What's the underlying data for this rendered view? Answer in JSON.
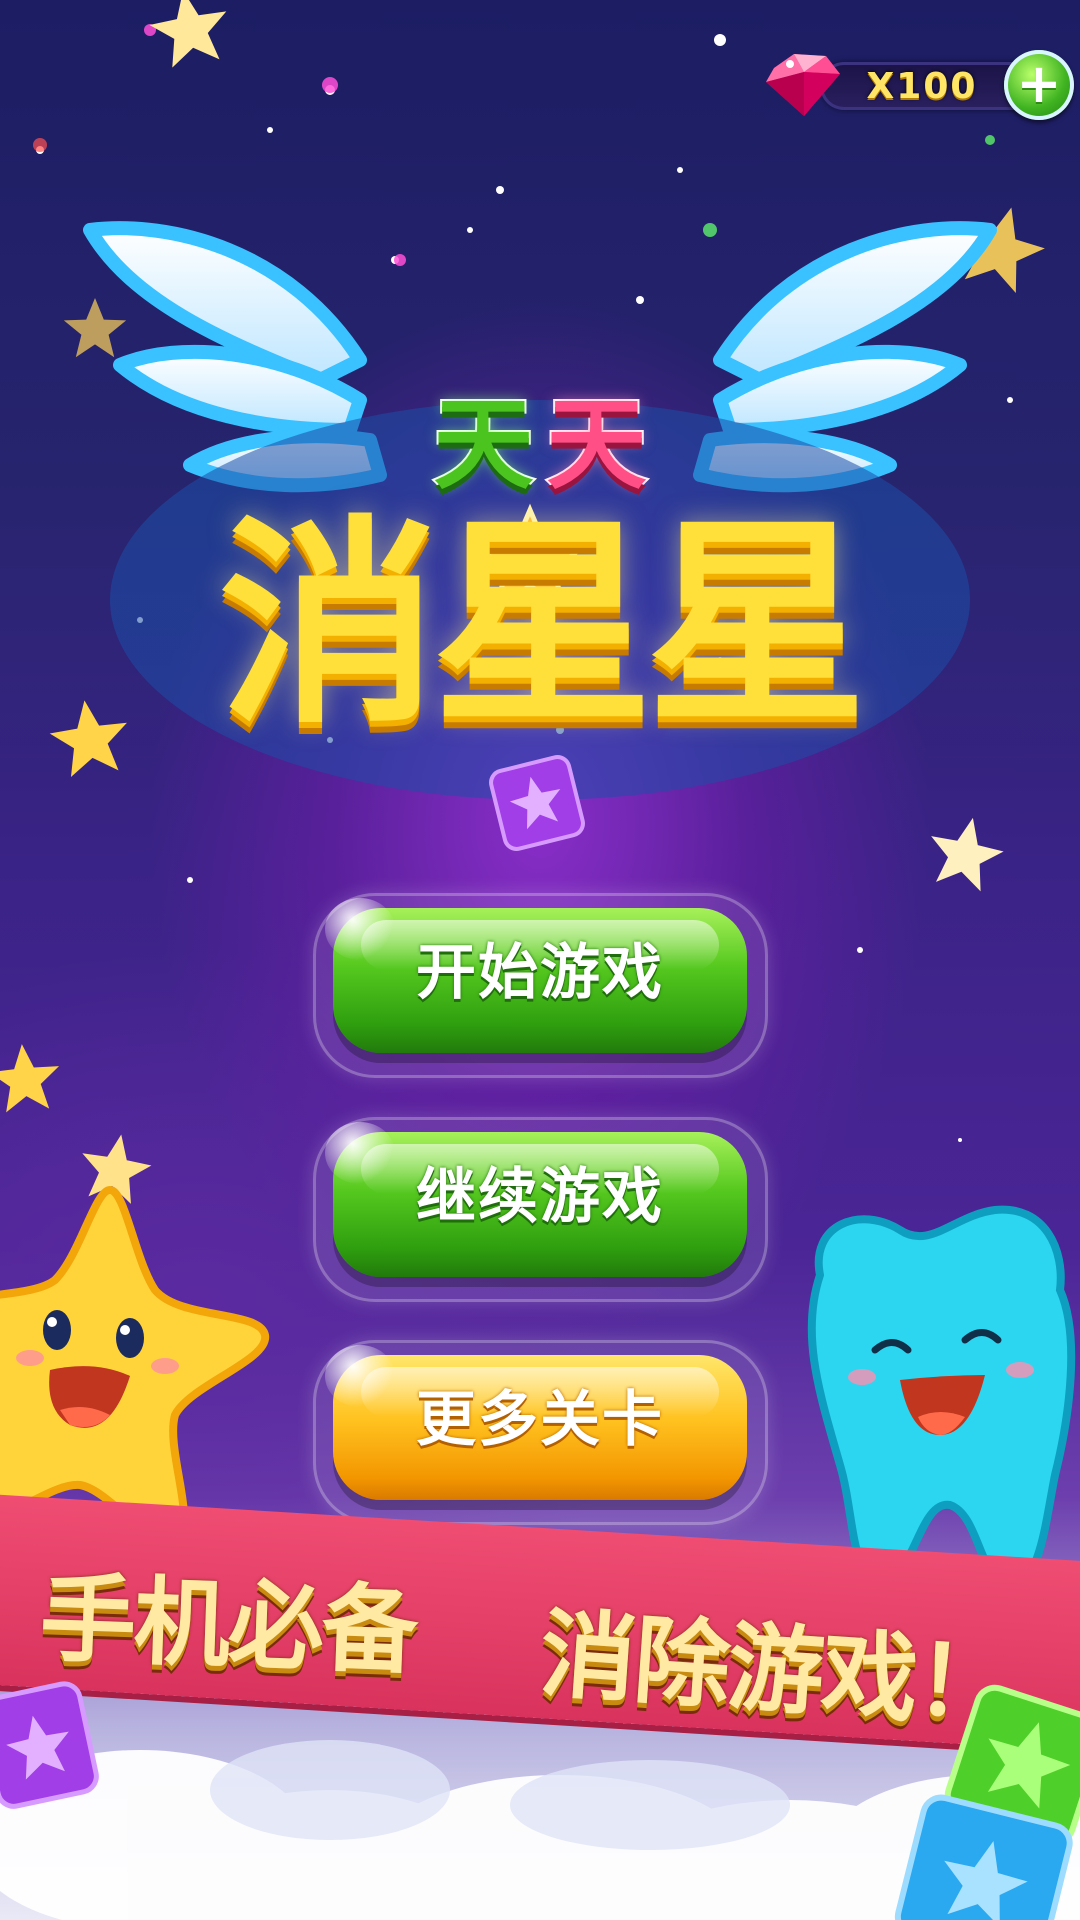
{
  "hud": {
    "gem_count": "X100",
    "add_icon": "plus-icon",
    "gem_icon": "gem-icon"
  },
  "logo": {
    "line1": [
      "天",
      "天"
    ],
    "line2": "消星星"
  },
  "menu": {
    "buttons": [
      {
        "label": "开始游戏",
        "style": "green"
      },
      {
        "label": "继续游戏",
        "style": "green"
      },
      {
        "label": "更多关卡",
        "style": "orange"
      }
    ]
  },
  "banner": {
    "left": "手机必备",
    "right": "消除游戏！"
  },
  "colors": {
    "accent_green": "#56c91f",
    "accent_orange": "#ffc21f",
    "banner_red": "#e0395f",
    "logo_yellow": "#ffdf3a"
  }
}
